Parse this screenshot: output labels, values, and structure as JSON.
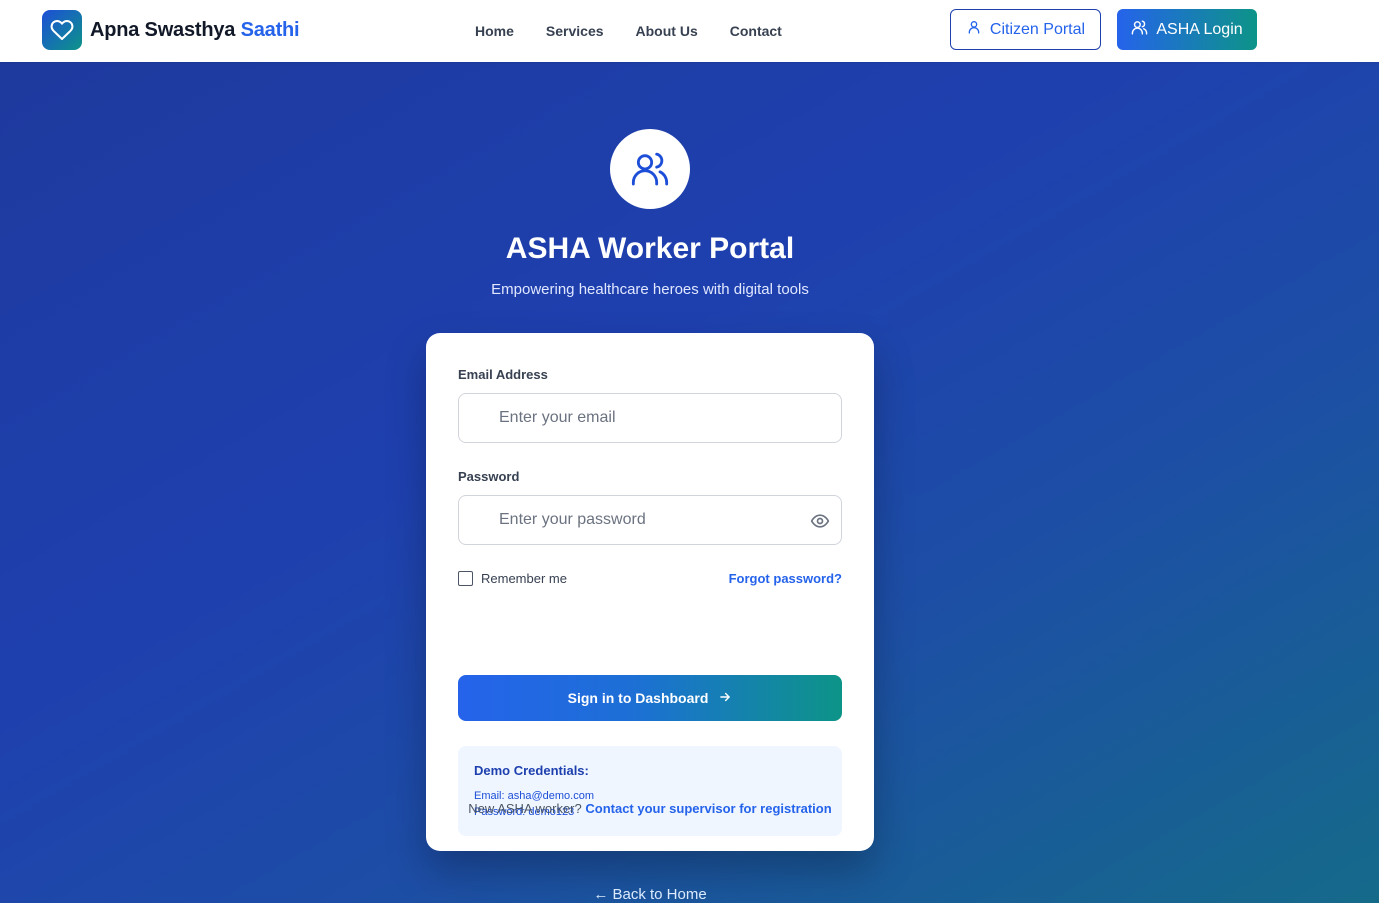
{
  "header": {
    "brand_name": "Apna Swasthya",
    "brand_accent": "Saathi",
    "logo_icon": "heart-icon",
    "nav": [
      "Home",
      "Services",
      "About Us",
      "Contact"
    ],
    "citizen_portal": "Citizen Portal",
    "asha_login": "ASHA Login"
  },
  "hero": {
    "icon": "users-icon",
    "title": "ASHA Worker Portal",
    "subtitle": "Empowering healthcare heroes with digital tools"
  },
  "form": {
    "email_label": "Email Address",
    "email_placeholder": "Enter your email",
    "email_value": "",
    "password_label": "Password",
    "password_placeholder": "Enter your password",
    "password_value": "",
    "remember_label": "Remember me",
    "remember_checked": false,
    "forgot_link": "Forgot password?",
    "submit_label": "Sign in to Dashboard"
  },
  "demo": {
    "title": "Demo Credentials:",
    "email_line": "Email: asha@demo.com",
    "password_line": "Password: demo123"
  },
  "register": {
    "prompt": "New ASHA worker?",
    "link": "Contact your supervisor for registration"
  },
  "back_link": "← Back to Home",
  "colors": {
    "primary": "#2563eb",
    "teal": "#0d9488",
    "hero_bg": "#1e40af"
  }
}
